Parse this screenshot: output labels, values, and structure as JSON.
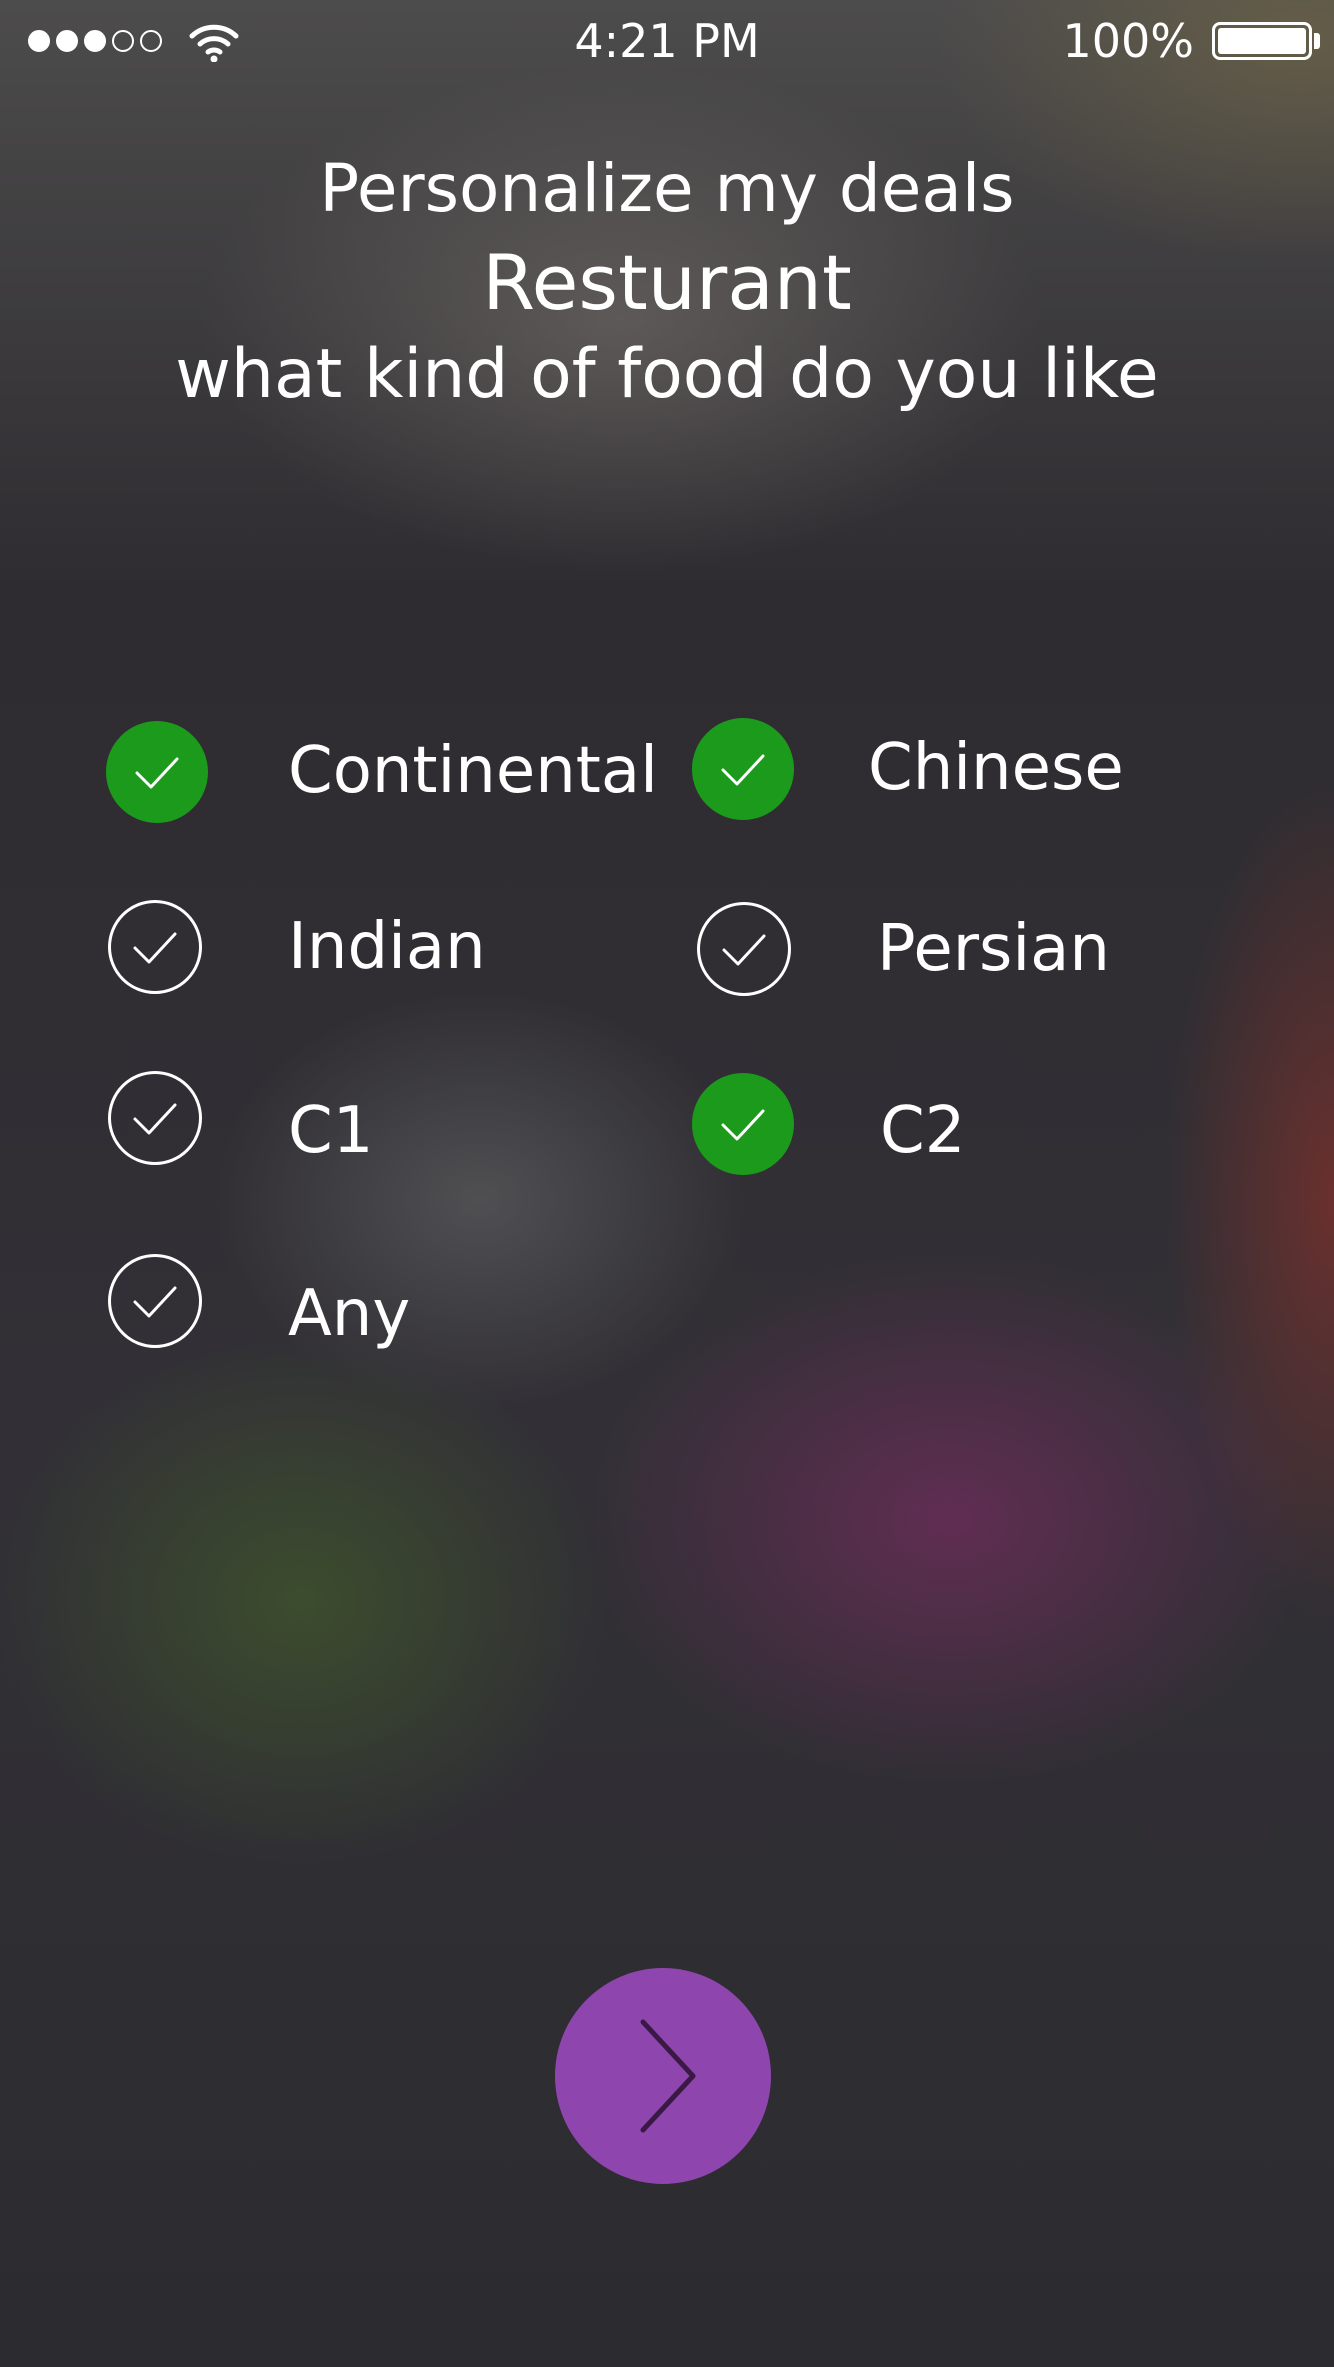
{
  "status_bar": {
    "signal_filled": 3,
    "signal_total": 5,
    "time": "4:21 PM",
    "battery_percent": "100%",
    "battery_level": 1.0
  },
  "header": {
    "title": "Personalize my deals",
    "category": "Resturant",
    "prompt": "what kind of food do you like"
  },
  "options": [
    {
      "label": "Continental",
      "selected": true
    },
    {
      "label": "Chinese",
      "selected": true
    },
    {
      "label": "Indian",
      "selected": false
    },
    {
      "label": "Persian",
      "selected": false
    },
    {
      "label": "C1",
      "selected": false
    },
    {
      "label": "C2",
      "selected": true
    },
    {
      "label": "Any",
      "selected": false
    }
  ],
  "colors": {
    "selected_check": "#1c9a1c",
    "next_button": "#8e45ad",
    "next_arrow": "#3a1a44"
  },
  "icons": {
    "check": "checkmark-icon",
    "next": "chevron-right-icon",
    "wifi": "wifi-icon",
    "battery": "battery-icon"
  }
}
